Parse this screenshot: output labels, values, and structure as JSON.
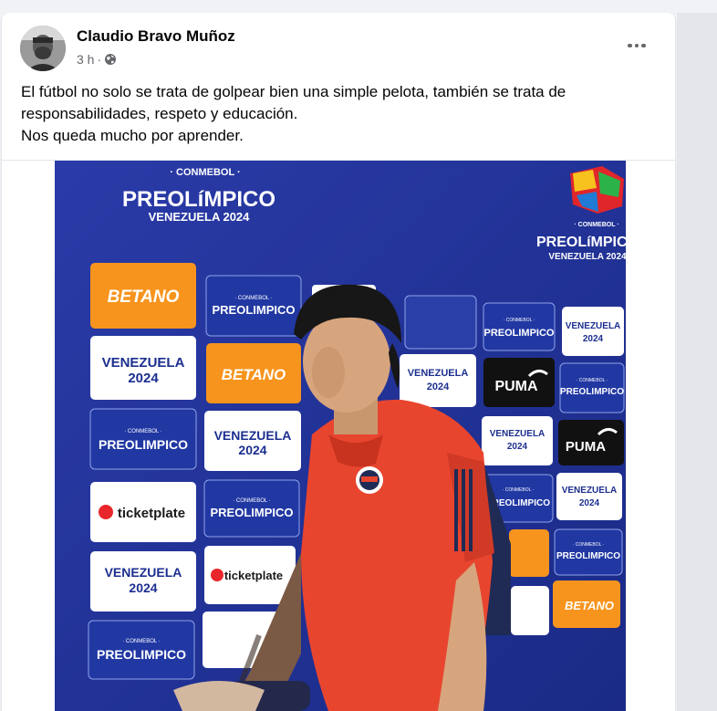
{
  "post": {
    "author": "Claudio Bravo Muñoz",
    "time": "3 h",
    "separator": "·",
    "audience_icon": "globe-icon",
    "more_icon": "more-options-icon",
    "text_lines": [
      "El fútbol no solo se trata de golpear bien una simple pelota, también se trata de",
      "responsabilidades, respeto y educación.",
      "Nos queda mucho por aprender."
    ]
  },
  "media": {
    "backdrop_header": {
      "org": "· CONMEBOL ·",
      "tournament": "PREOLíMPICO",
      "host": "VENEZUELA 2024"
    },
    "sponsors": {
      "betano": "BETANO",
      "preolimpico_small": "· CONMEBOL ·",
      "preolimpico": "PREOLIMPICO",
      "venezuela": "VENEZUELA",
      "year": "2024",
      "puma": "PUMA",
      "ticketplate": "ticketplate"
    }
  },
  "colors": {
    "backdrop_blue": "#1c2f8f",
    "shirt_red": "#e8452f",
    "betano_orange": "#f7941d",
    "meta_gray": "#65676b"
  }
}
